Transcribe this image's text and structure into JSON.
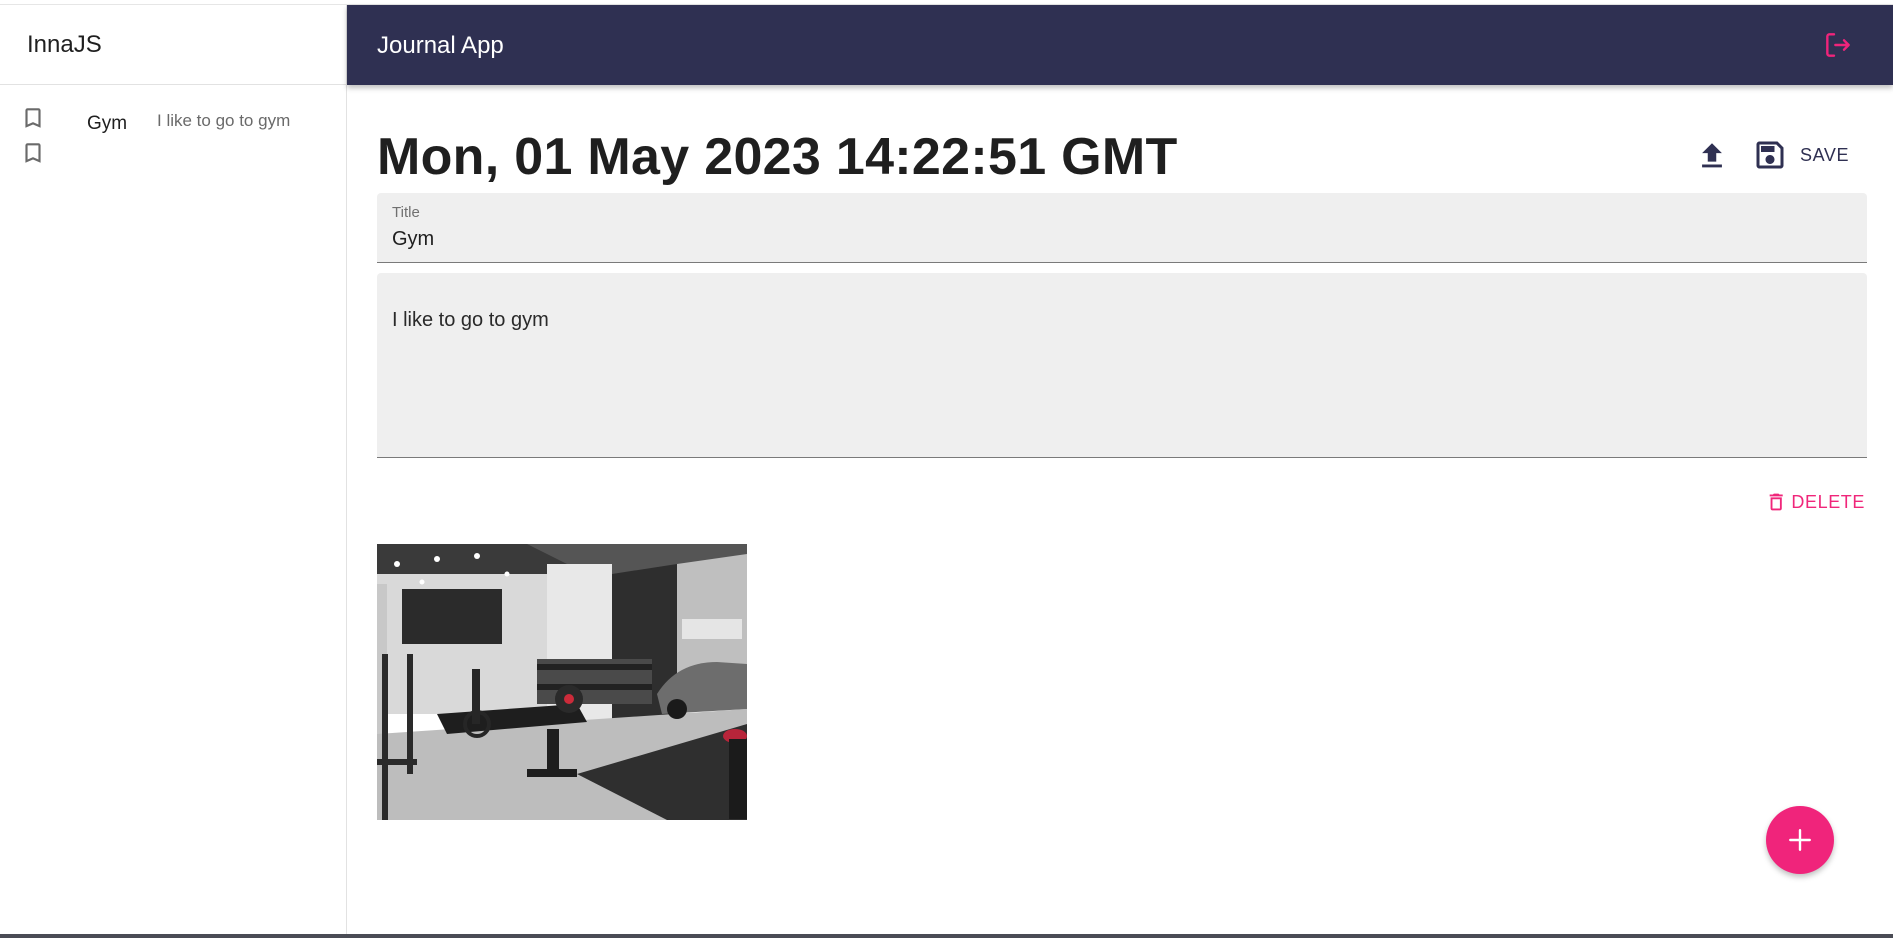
{
  "sidebar": {
    "user_name": "InnaJS",
    "notes": [
      {
        "title": "Gym",
        "body": "I like to go to gym"
      },
      {
        "title": "",
        "body": ""
      }
    ]
  },
  "appbar": {
    "title": "Journal App"
  },
  "note": {
    "date": "Mon, 01 May 2023 14:22:51 GMT",
    "title_label": "Title",
    "title_value": "Gym",
    "body_value": "I like to go to gym"
  },
  "actions": {
    "save_label": "SAVE",
    "delete_label": "DELETE"
  },
  "icons": {
    "bookmark": "bookmark-outline-icon",
    "logout": "logout-icon",
    "upload": "upload-icon",
    "save": "floppy-disk-icon",
    "delete": "trash-icon",
    "add": "plus-icon"
  },
  "colors": {
    "appbar": "#2f3052",
    "accent": "#f0247b",
    "field_bg": "#efefef"
  }
}
